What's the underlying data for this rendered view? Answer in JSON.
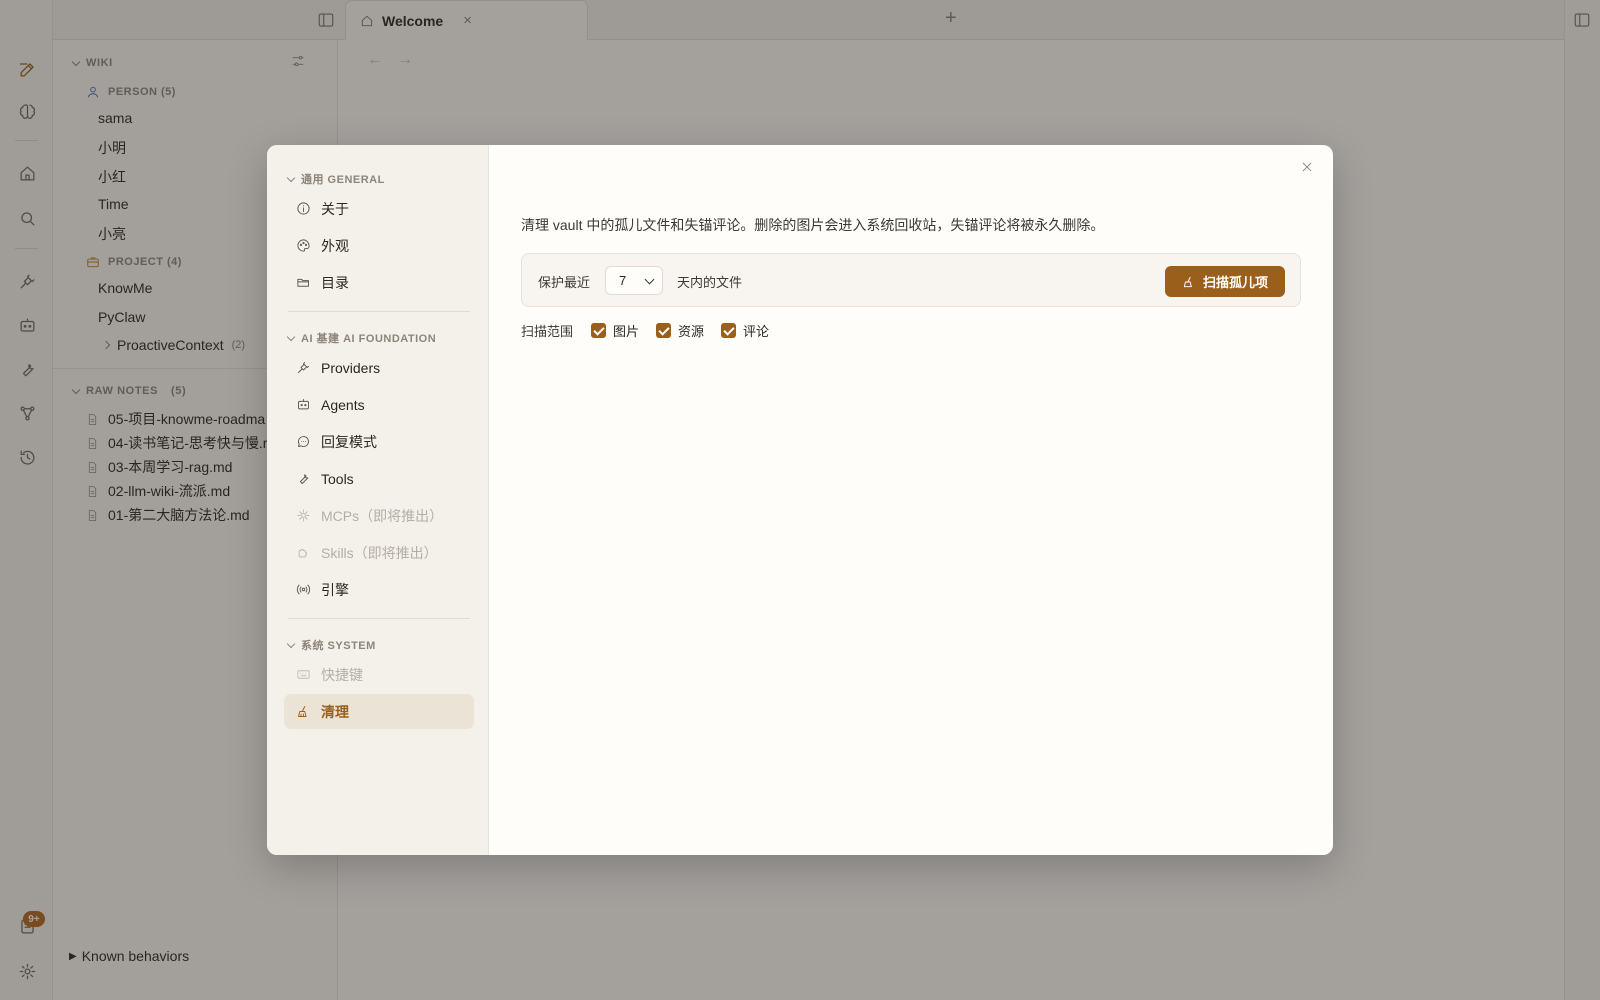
{
  "tabs": [
    {
      "label": "Welcome"
    }
  ],
  "main": {
    "title": ""
  },
  "rail": {
    "badge": "9+"
  },
  "sidebar": {
    "wiki_header": "WIKI",
    "groups": [
      {
        "label": "PERSON (5)",
        "items": [
          "sama",
          "小明",
          "小红",
          "Time",
          "小亮"
        ]
      },
      {
        "label": "PROJECT (4)",
        "items": [
          "KnowMe",
          "PyClaw"
        ],
        "subfolder": {
          "label": "ProactiveContext",
          "count": "(2)"
        }
      }
    ],
    "raw_notes": {
      "header": "RAW NOTES",
      "count": "(5)",
      "items": [
        "05-项目-knowme-roadma",
        "04-读书笔记-思考快与慢.r",
        "03-本周学习-rag.md",
        "02-llm-wiki-流派.md",
        "01-第二大脑方法论.md"
      ]
    },
    "known_behaviors": "Known behaviors"
  },
  "settings": {
    "sections": [
      {
        "header": "通用 GENERAL",
        "items": [
          {
            "label": "关于",
            "icon": "info-icon"
          },
          {
            "label": "外观",
            "icon": "palette-icon"
          },
          {
            "label": "目录",
            "icon": "folder-open-icon"
          }
        ]
      },
      {
        "header": "AI 基建 AI FOUNDATION",
        "items": [
          {
            "label": "Providers",
            "icon": "plug-icon"
          },
          {
            "label": "Agents",
            "icon": "bot-icon"
          },
          {
            "label": "回复模式",
            "icon": "message-icon"
          },
          {
            "label": "Tools",
            "icon": "wrench-icon"
          },
          {
            "label": "MCPs（即将推出）",
            "icon": "mcp-icon",
            "disabled": true
          },
          {
            "label": "Skills（即将推出）",
            "icon": "puzzle-icon",
            "disabled": true
          },
          {
            "label": "引擎",
            "icon": "broadcast-icon"
          }
        ]
      },
      {
        "header": "系统 SYSTEM",
        "items": [
          {
            "label": "快捷键",
            "icon": "keyboard-icon",
            "disabled": true
          },
          {
            "label": "清理",
            "icon": "broom-icon",
            "active": true
          }
        ]
      }
    ],
    "cleanup": {
      "description": "清理 vault 中的孤儿文件和失锚评论。删除的图片会进入系统回收站，失锚评论将被永久删除。",
      "protect_label": "保护最近",
      "days_value": "7",
      "days_suffix": "天内的文件",
      "scan_button": "扫描孤儿项",
      "scope_label": "扫描范围",
      "scope_options": [
        {
          "label": "图片",
          "checked": true
        },
        {
          "label": "资源",
          "checked": true
        },
        {
          "label": "评论",
          "checked": true
        }
      ]
    }
  },
  "colors": {
    "accent": "#9b5f1c",
    "person_icon": "#5563c9",
    "project_icon": "#c07a32"
  }
}
